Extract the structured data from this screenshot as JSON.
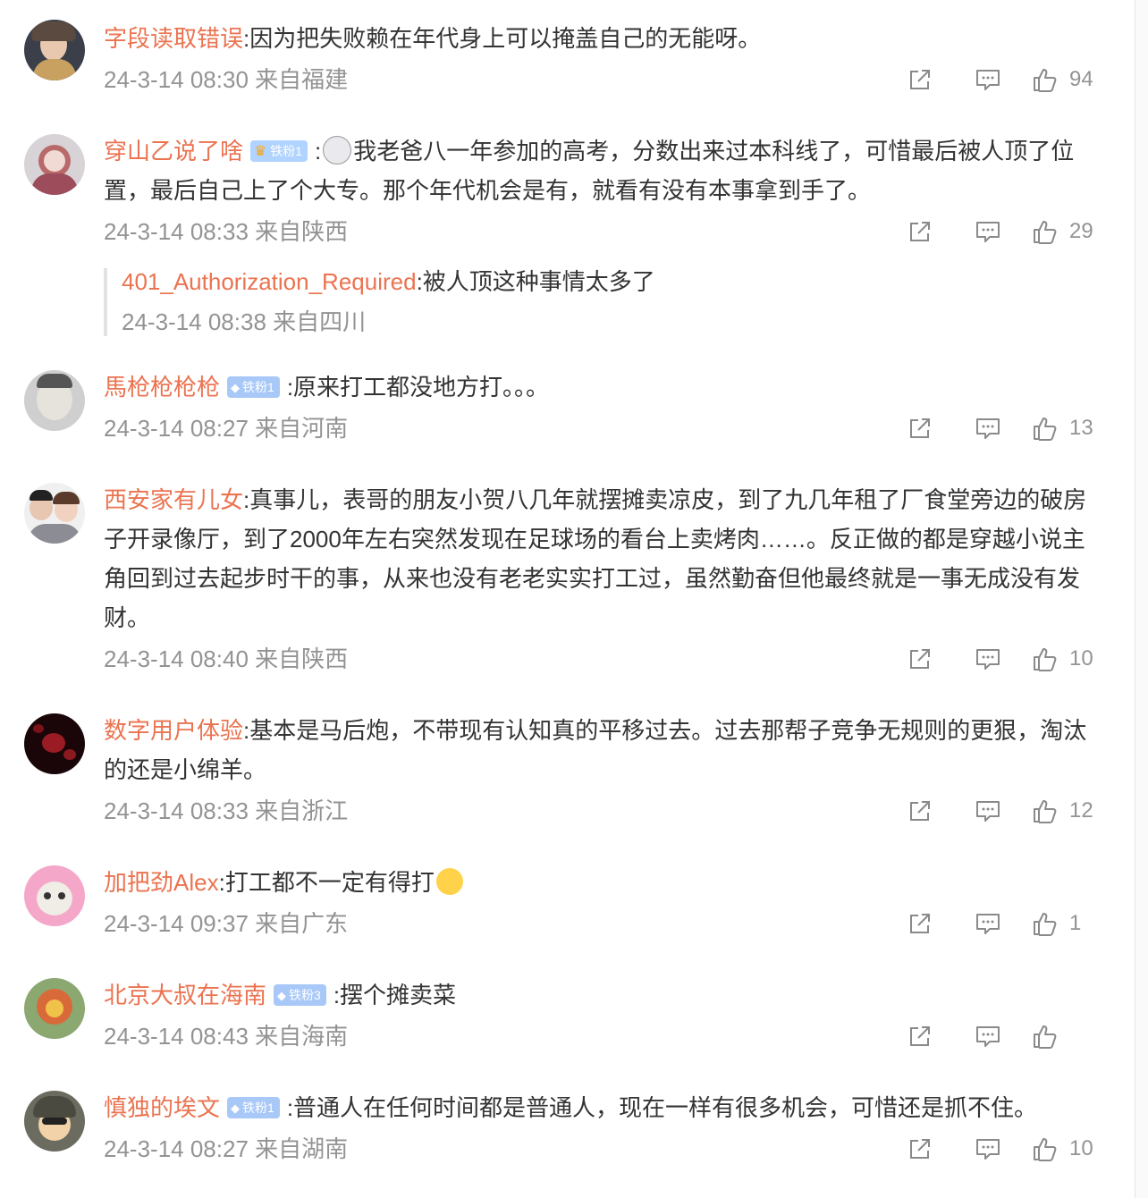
{
  "comments": [
    {
      "username": "字段读取错误",
      "badge": "",
      "text": ":因为把失败赖在年代身上可以掩盖自己的无能呀。",
      "meta": "24-3-14 08:30 来自福建",
      "likes": "94"
    },
    {
      "username": "穿山乙说了啥",
      "badge": "铁粉1",
      "text_before": ":",
      "text": "我老爸八一年参加的高考，分数出来过本科线了，可惜最后被人顶了位置，最后自己上了个大专。那个年代机会是有，就看有没有本事拿到手了。",
      "meta": "24-3-14 08:33 来自陕西",
      "likes": "29",
      "reply": {
        "username": "401_Authorization_Required",
        "text": ":被人顶这种事情太多了",
        "meta": "24-3-14 08:38 来自四川"
      }
    },
    {
      "username": "馬枪枪枪枪",
      "badge": "铁粉1",
      "text": ":原来打工都没地方打。。。",
      "meta": "24-3-14 08:27 来自河南",
      "likes": "13"
    },
    {
      "username": "西安家有儿女",
      "badge": "",
      "text": ":真事儿，表哥的朋友小贺八几年就摆摊卖凉皮，到了九几年租了厂食堂旁边的破房子开录像厅，到了2000年左右突然发现在足球场的看台上卖烤肉……。反正做的都是穿越小说主角回到过去起步时干的事，从来也没有老老实实打工过，虽然勤奋但他最终就是一事无成没有发财。",
      "meta": "24-3-14 08:40 来自陕西",
      "likes": "10"
    },
    {
      "username": "数字用户体验",
      "badge": "",
      "text": ":基本是马后炮，不带现有认知真的平移过去。过去那帮子竞争无规则的更狠，淘汰的还是小绵羊。",
      "meta": "24-3-14 08:33 来自浙江",
      "likes": "12"
    },
    {
      "username": "加把劲Alex",
      "badge": "",
      "text": ":打工都不一定有得打",
      "meta": "24-3-14 09:37 来自广东",
      "likes": "1"
    },
    {
      "username": "北京大叔在海南",
      "badge": "铁粉3",
      "text": ":摆个摊卖菜",
      "meta": "24-3-14 08:43 来自海南",
      "likes": ""
    },
    {
      "username": "慎独的埃文",
      "badge": "铁粉1",
      "text": ":普通人在任何时间都是普通人，现在一样有很多机会，可惜还是抓不住。",
      "meta": "24-3-14 08:27 来自湖南",
      "likes": "10"
    }
  ],
  "icons": {
    "share": "share-icon",
    "comment": "comment-icon",
    "like": "thumbs-up-icon",
    "badge_gem": "diamond-icon",
    "badge_crown": "crown-icon"
  },
  "colors": {
    "username": "#eb7350",
    "text": "#333333",
    "meta": "#939393",
    "badge_bg": "#a8c8f8"
  }
}
